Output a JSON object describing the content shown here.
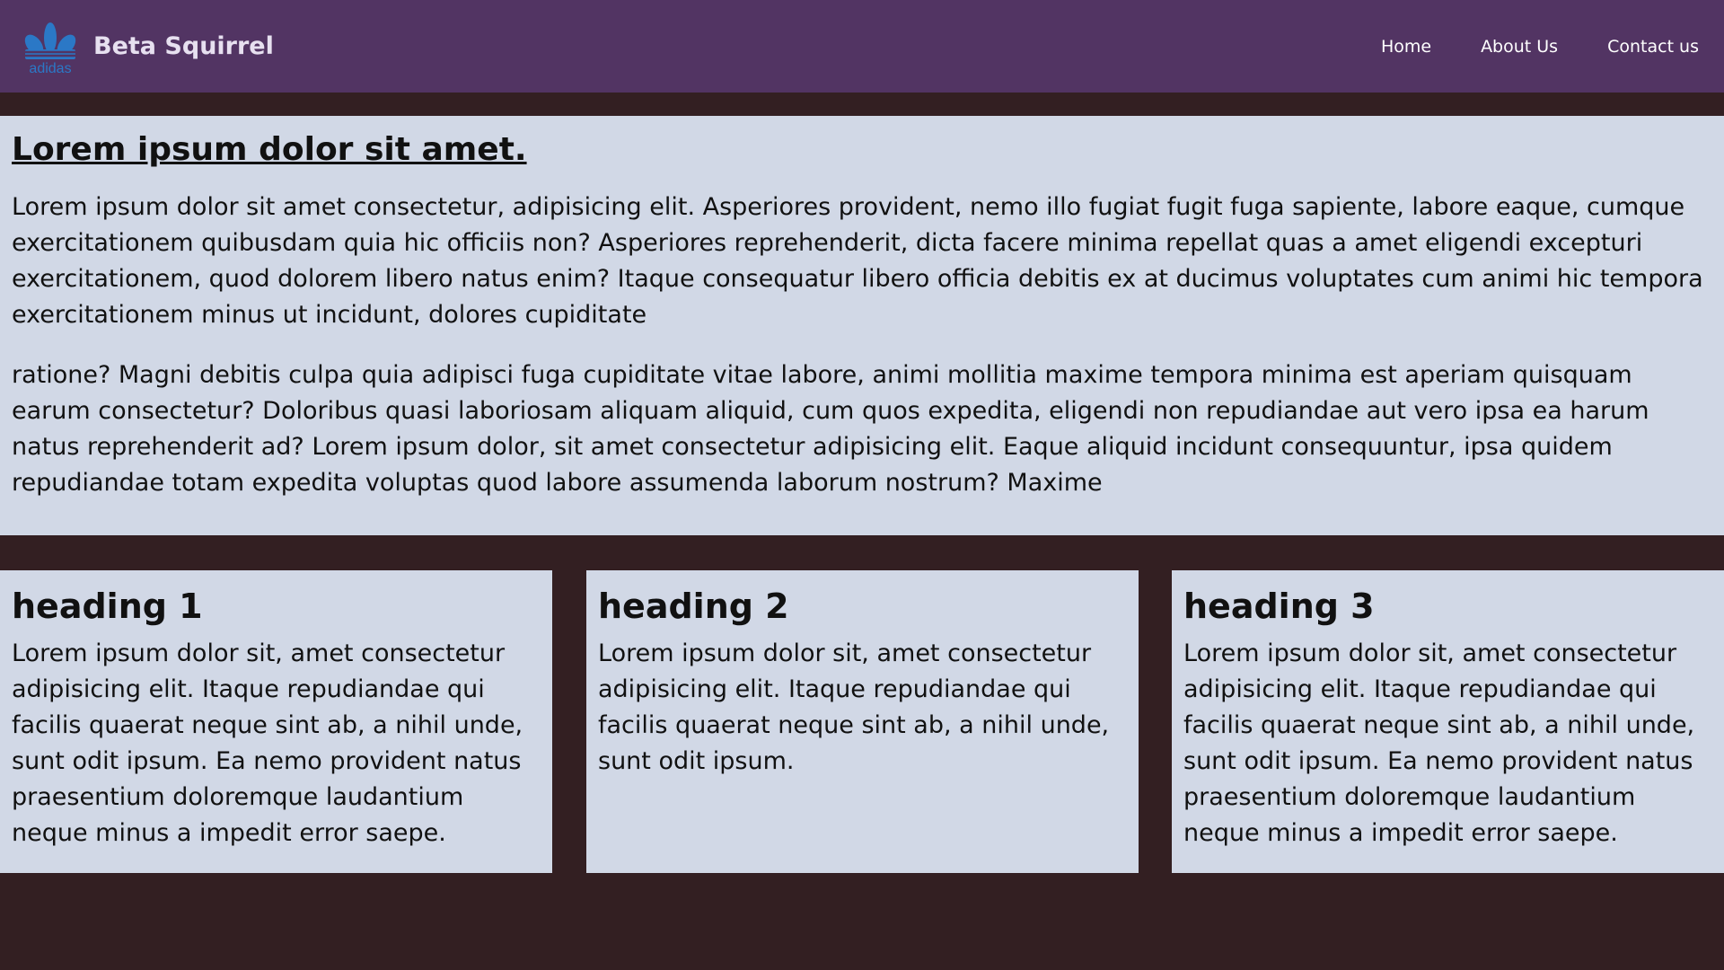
{
  "brand": {
    "logo_text": "adidas",
    "name": "Beta Squirrel",
    "logo_color": "#2b78c6"
  },
  "nav": {
    "links": [
      "Home",
      "About Us",
      "Contact us"
    ]
  },
  "main": {
    "title": "Lorem ipsum dolor sit amet.",
    "paragraphs": [
      "Lorem ipsum dolor sit amet consectetur, adipisicing elit. Asperiores provident, nemo illo fugiat fugit fuga sapiente, labore eaque, cumque exercitationem quibusdam quia hic officiis non? Asperiores reprehenderit, dicta facere minima repellat quas a amet eligendi excepturi exercitationem, quod dolorem libero natus enim? Itaque consequatur libero officia debitis ex at ducimus voluptates cum animi hic tempora exercitationem minus ut incidunt, dolores cupiditate",
      "ratione? Magni debitis culpa quia adipisci fuga cupiditate vitae labore, animi mollitia maxime tempora minima est aperiam quisquam earum consectetur? Doloribus quasi laboriosam aliquam aliquid, cum quos expedita, eligendi non repudiandae aut vero ipsa ea harum natus reprehenderit ad? Lorem ipsum dolor, sit amet consectetur adipisicing elit. Eaque aliquid incidunt consequuntur, ipsa quidem repudiandae totam expedita voluptas quod labore assumenda laborum nostrum? Maxime"
    ]
  },
  "cards": [
    {
      "heading": "heading 1",
      "text": "Lorem ipsum dolor sit, amet consectetur adipisicing elit. Itaque repudiandae qui facilis quaerat neque sint ab, a nihil unde, sunt odit ipsum. Ea nemo provident natus praesentium doloremque laudantium neque minus a impedit error saepe."
    },
    {
      "heading": "heading 2",
      "text": "Lorem ipsum dolor sit, amet consectetur adipisicing elit. Itaque repudiandae qui facilis quaerat neque sint ab, a nihil unde, sunt odit ipsum."
    },
    {
      "heading": "heading 3",
      "text": "Lorem ipsum dolor sit, amet consectetur adipisicing elit. Itaque repudiandae qui facilis quaerat neque sint ab, a nihil unde, sunt odit ipsum. Ea nemo provident natus praesentium doloremque laudantium neque minus a impedit error saepe."
    }
  ],
  "colors": {
    "navbar": "#523463",
    "page_background": "#331f22",
    "content_background": "#d1d8e6",
    "text": "#111111",
    "nav_text": "#ffffff"
  }
}
